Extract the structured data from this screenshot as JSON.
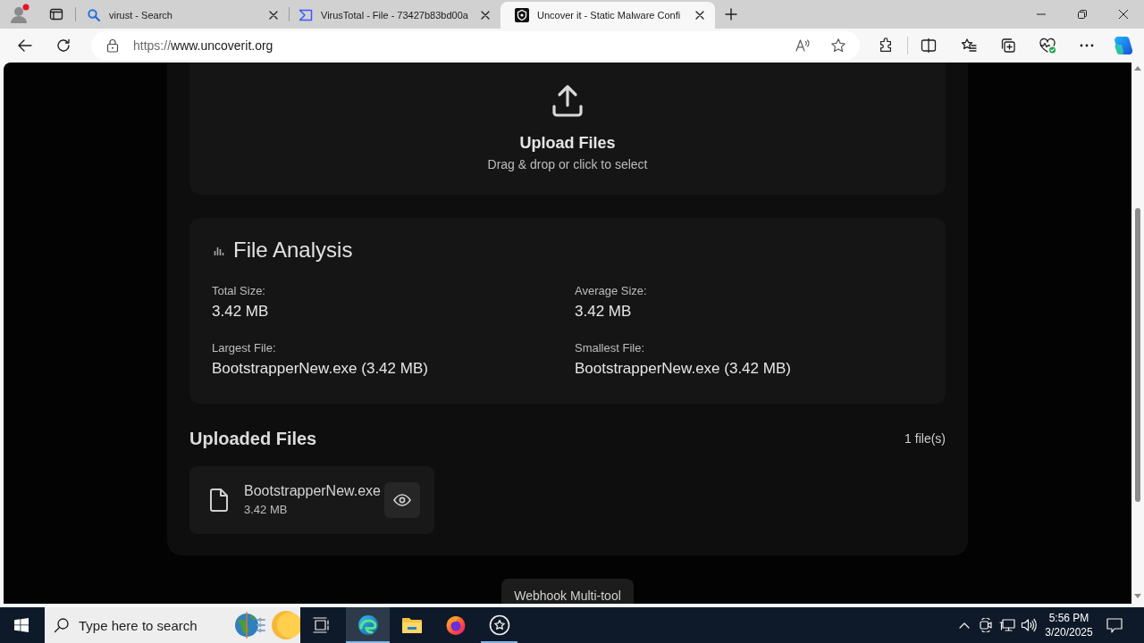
{
  "browser": {
    "tabs": [
      {
        "kind": "search",
        "title": "virust - Search",
        "selected": false
      },
      {
        "kind": "virustotal",
        "title": "VirusTotal - File - 73427b83bd00a",
        "selected": false
      },
      {
        "kind": "uncoverit",
        "title": "Uncover it - Static Malware Confi",
        "selected": true
      }
    ],
    "url": {
      "scheme": "https://",
      "host": "www.uncoverit.org"
    }
  },
  "upload": {
    "title": "Upload Files",
    "hint": "Drag & drop or click to select"
  },
  "analysis": {
    "title": "File Analysis",
    "stats": [
      {
        "label": "Total Size:",
        "value": "3.42 MB"
      },
      {
        "label": "Average Size:",
        "value": "3.42 MB"
      },
      {
        "label": "Largest File:",
        "value": "BootstrapperNew.exe (3.42 MB)"
      },
      {
        "label": "Smallest File:",
        "value": "BootstrapperNew.exe (3.42 MB)"
      }
    ]
  },
  "uploaded": {
    "title": "Uploaded Files",
    "count": "1 file(s)",
    "files": [
      {
        "name": "BootstrapperNew.exe",
        "size": "3.42 MB"
      }
    ]
  },
  "footer": {
    "button": "Webhook Multi-tool"
  },
  "taskbar": {
    "search": {
      "placeholder": "Type here to search"
    },
    "apps": [
      {
        "kind": "edge",
        "selected": true,
        "running": true
      },
      {
        "kind": "explorer",
        "selected": false,
        "running": false
      },
      {
        "kind": "firefox",
        "selected": false,
        "running": false
      },
      {
        "kind": "star",
        "selected": false,
        "running": true
      }
    ],
    "time": "5:56 PM",
    "date": "3/20/2025"
  }
}
